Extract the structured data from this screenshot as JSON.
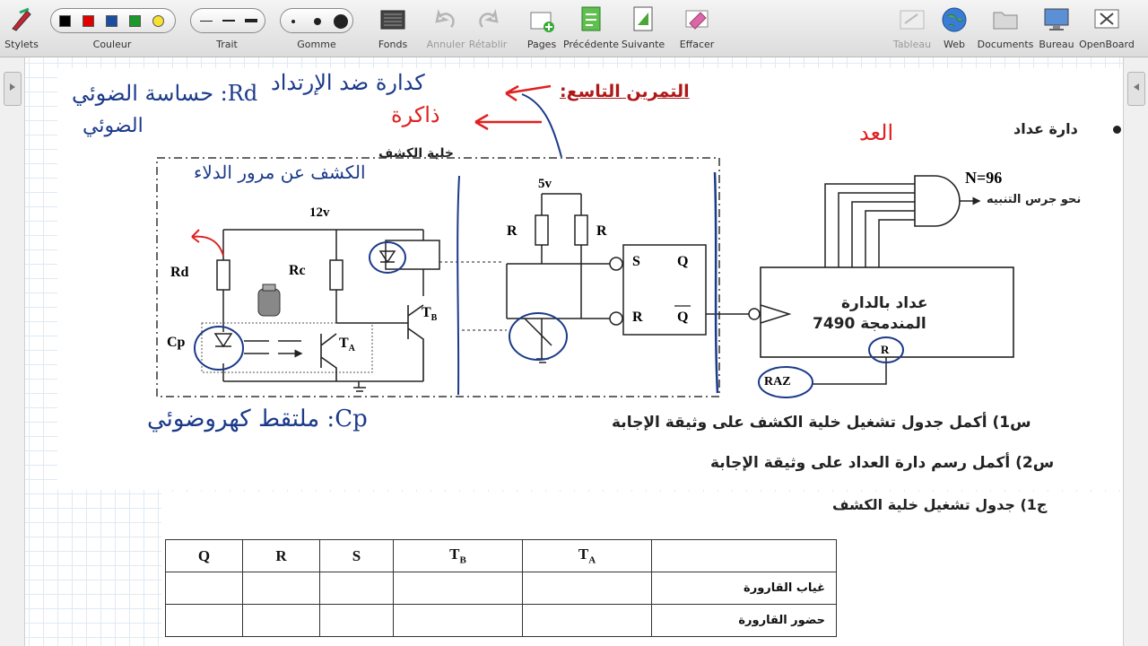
{
  "toolbar": {
    "items": [
      {
        "label": "Stylets",
        "icon": "stylus-icon"
      },
      {
        "label": "Couleur",
        "icon": "color-palette"
      },
      {
        "label": "Trait",
        "icon": "stroke-width"
      },
      {
        "label": "Gomme",
        "icon": "eraser-size"
      },
      {
        "label": "Fonds",
        "icon": "background-icon"
      },
      {
        "label": "Annuler",
        "icon": "undo-icon",
        "disabled": true
      },
      {
        "label": "Rétablir",
        "icon": "redo-icon",
        "disabled": true
      },
      {
        "label": "Pages",
        "icon": "pages-icon"
      },
      {
        "label": "Précédente",
        "icon": "previous-page-icon"
      },
      {
        "label": "Suivante",
        "icon": "next-page-icon"
      },
      {
        "label": "Effacer",
        "icon": "clear-icon"
      },
      {
        "label": "Tableau",
        "icon": "board-icon",
        "disabled": true
      },
      {
        "label": "Web",
        "icon": "globe-icon"
      },
      {
        "label": "Documents",
        "icon": "folder-icon"
      },
      {
        "label": "Bureau",
        "icon": "desktop-icon"
      },
      {
        "label": "OpenBoard",
        "icon": "openboard-icon"
      }
    ],
    "colors": [
      "#000000",
      "#e00000",
      "#1a4fa0",
      "#1a9a2a",
      "#f6e030"
    ]
  },
  "exercise": {
    "title": "التمرين التاسع:",
    "bullet_counter": "دارة عداد",
    "detection_cell": "خلية الكشف",
    "n_value": "N=96",
    "bell_text": "نحو جرس التنبيه",
    "counter_line1": "عداد بالدارة",
    "counter_line2": "المندمجة 7490",
    "raz": "RAZ",
    "r_pin": "R",
    "v12": "12v",
    "v5": "5v",
    "rd": "Rd",
    "rc": "Rc",
    "cp": "Cp",
    "ta": "T",
    "ta_sub": "A",
    "tb": "T",
    "tb_sub": "B",
    "r1": "R",
    "r2": "R",
    "s_pin": "S",
    "r_pin2": "R",
    "q_pin": "Q",
    "qbar_pin": "Q",
    "q1": "س1) أكمل جدول تشغيل خلية الكشف على وثيقة الإجابة",
    "q2": "س2) أكمل رسم دارة العداد على وثيقة الإجابة",
    "a1": "ج1) جدول تشغيل خلية الكشف"
  },
  "annotations": {
    "rd_note_1": "Rd: حساسة الضوئي",
    "rd_note_2": "الضوئي",
    "memory_1": "كدارة ضد الإرتداد",
    "memory_2": "ذاكرة",
    "counter_note": "العد",
    "detect_note": "الكشف عن مرور الدلاء",
    "cp_note": "Cp: ملتقط كهروضوئي"
  },
  "table": {
    "headers": [
      "Q",
      "R",
      "S",
      "T",
      "T",
      ""
    ],
    "header_subs": [
      "",
      "",
      "",
      "B",
      "A",
      ""
    ],
    "rows": [
      {
        "label": "غياب القارورة",
        "cells": [
          "",
          "",
          "",
          "",
          ""
        ]
      },
      {
        "label": "حضور القارورة",
        "cells": [
          "",
          "",
          "",
          "",
          ""
        ]
      }
    ]
  }
}
